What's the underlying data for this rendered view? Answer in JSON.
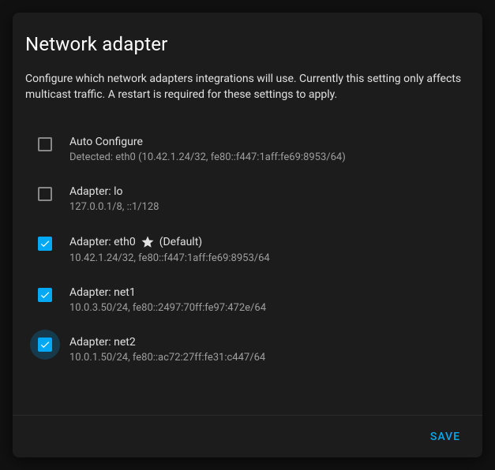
{
  "dialog": {
    "title": "Network adapter",
    "description": "Configure which network adapters integrations will use. Currently this setting only affects multicast traffic. A restart is required for these settings to apply.",
    "save_label": "SAVE"
  },
  "adapters": [
    {
      "checked": false,
      "label": "Auto Configure",
      "detail": "Detected: eth0 (10.42.1.24/32, fe80::f447:1aff:fe69:8953/64)",
      "default": false,
      "ripple": false
    },
    {
      "checked": false,
      "label": "Adapter: lo",
      "detail": "127.0.0.1/8, ::1/128",
      "default": false,
      "ripple": false
    },
    {
      "checked": true,
      "label": "Adapter: eth0",
      "default_suffix": "(Default)",
      "detail": "10.42.1.24/32, fe80::f447:1aff:fe69:8953/64",
      "default": true,
      "ripple": false
    },
    {
      "checked": true,
      "label": "Adapter: net1",
      "detail": "10.0.3.50/24, fe80::2497:70ff:fe97:472e/64",
      "default": false,
      "ripple": false
    },
    {
      "checked": true,
      "label": "Adapter: net2",
      "detail": "10.0.1.50/24, fe80::ac72:27ff:fe31:c447/64",
      "default": false,
      "ripple": true
    }
  ]
}
